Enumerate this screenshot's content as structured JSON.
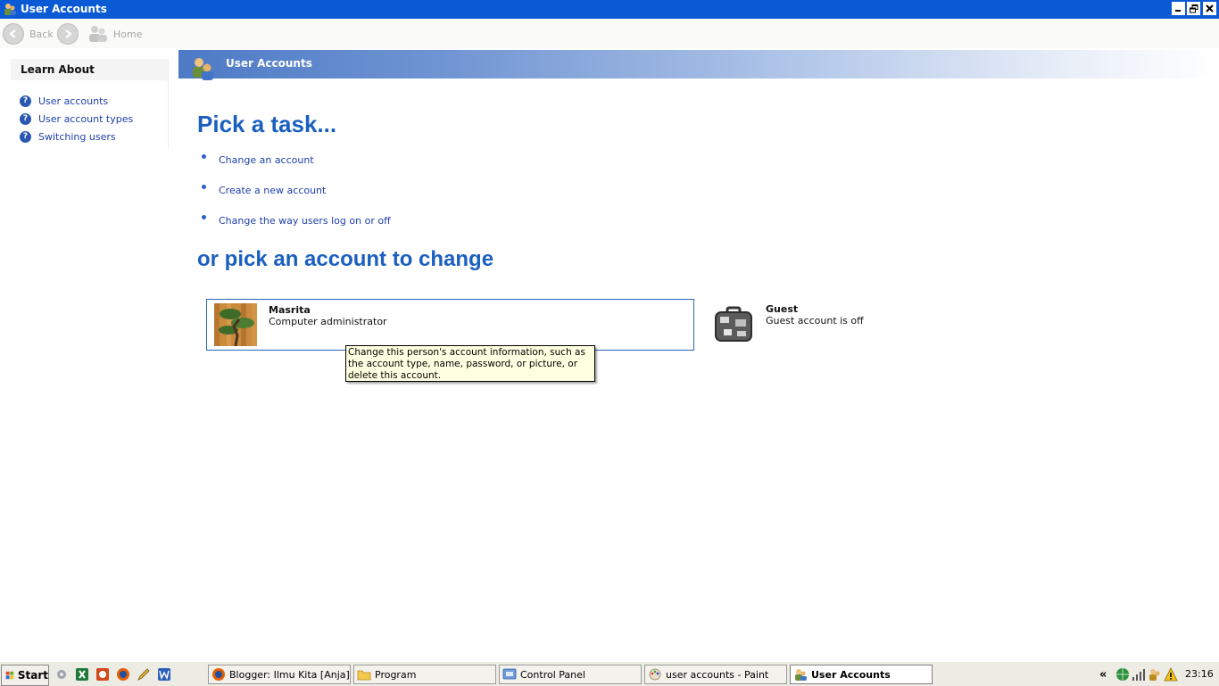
{
  "window": {
    "title": "User Accounts"
  },
  "nav": {
    "back_label": "Back",
    "home_label": "Home"
  },
  "learn_about": {
    "title": "Learn About",
    "links": [
      {
        "label": "User accounts"
      },
      {
        "label": "User account types"
      },
      {
        "label": "Switching users"
      }
    ]
  },
  "header": {
    "title": "User Accounts"
  },
  "main": {
    "pick_task_heading": "Pick a task...",
    "tasks": [
      {
        "label": "Change an account"
      },
      {
        "label": "Create a new account"
      },
      {
        "label": "Change the way users log on or off"
      }
    ],
    "pick_account_heading": "or pick an account to change",
    "accounts": [
      {
        "name": "Masrita",
        "type": "Computer administrator"
      },
      {
        "name": "Guest",
        "type": "Guest account is off"
      }
    ],
    "tooltip": "Change this person's account information, such as the account type, name, password, or picture, or delete this account."
  },
  "taskbar": {
    "start_label": "Start",
    "buttons": [
      {
        "label": "Blogger: Ilmu Kita [Anja] ...",
        "icon": "firefox-icon"
      },
      {
        "label": "Program",
        "icon": "folder-icon"
      },
      {
        "label": "Control Panel",
        "icon": "control-panel-icon"
      },
      {
        "label": "user accounts - Paint",
        "icon": "paint-icon"
      },
      {
        "label": "User Accounts",
        "icon": "user-accounts-icon",
        "active": true
      }
    ],
    "clock": "23:16"
  },
  "colors": {
    "titlebar": "#0a5ad6",
    "heading_blue": "#1b5fbf",
    "link_blue": "#1e3fa8",
    "tooltip_bg": "#ffffe1"
  }
}
